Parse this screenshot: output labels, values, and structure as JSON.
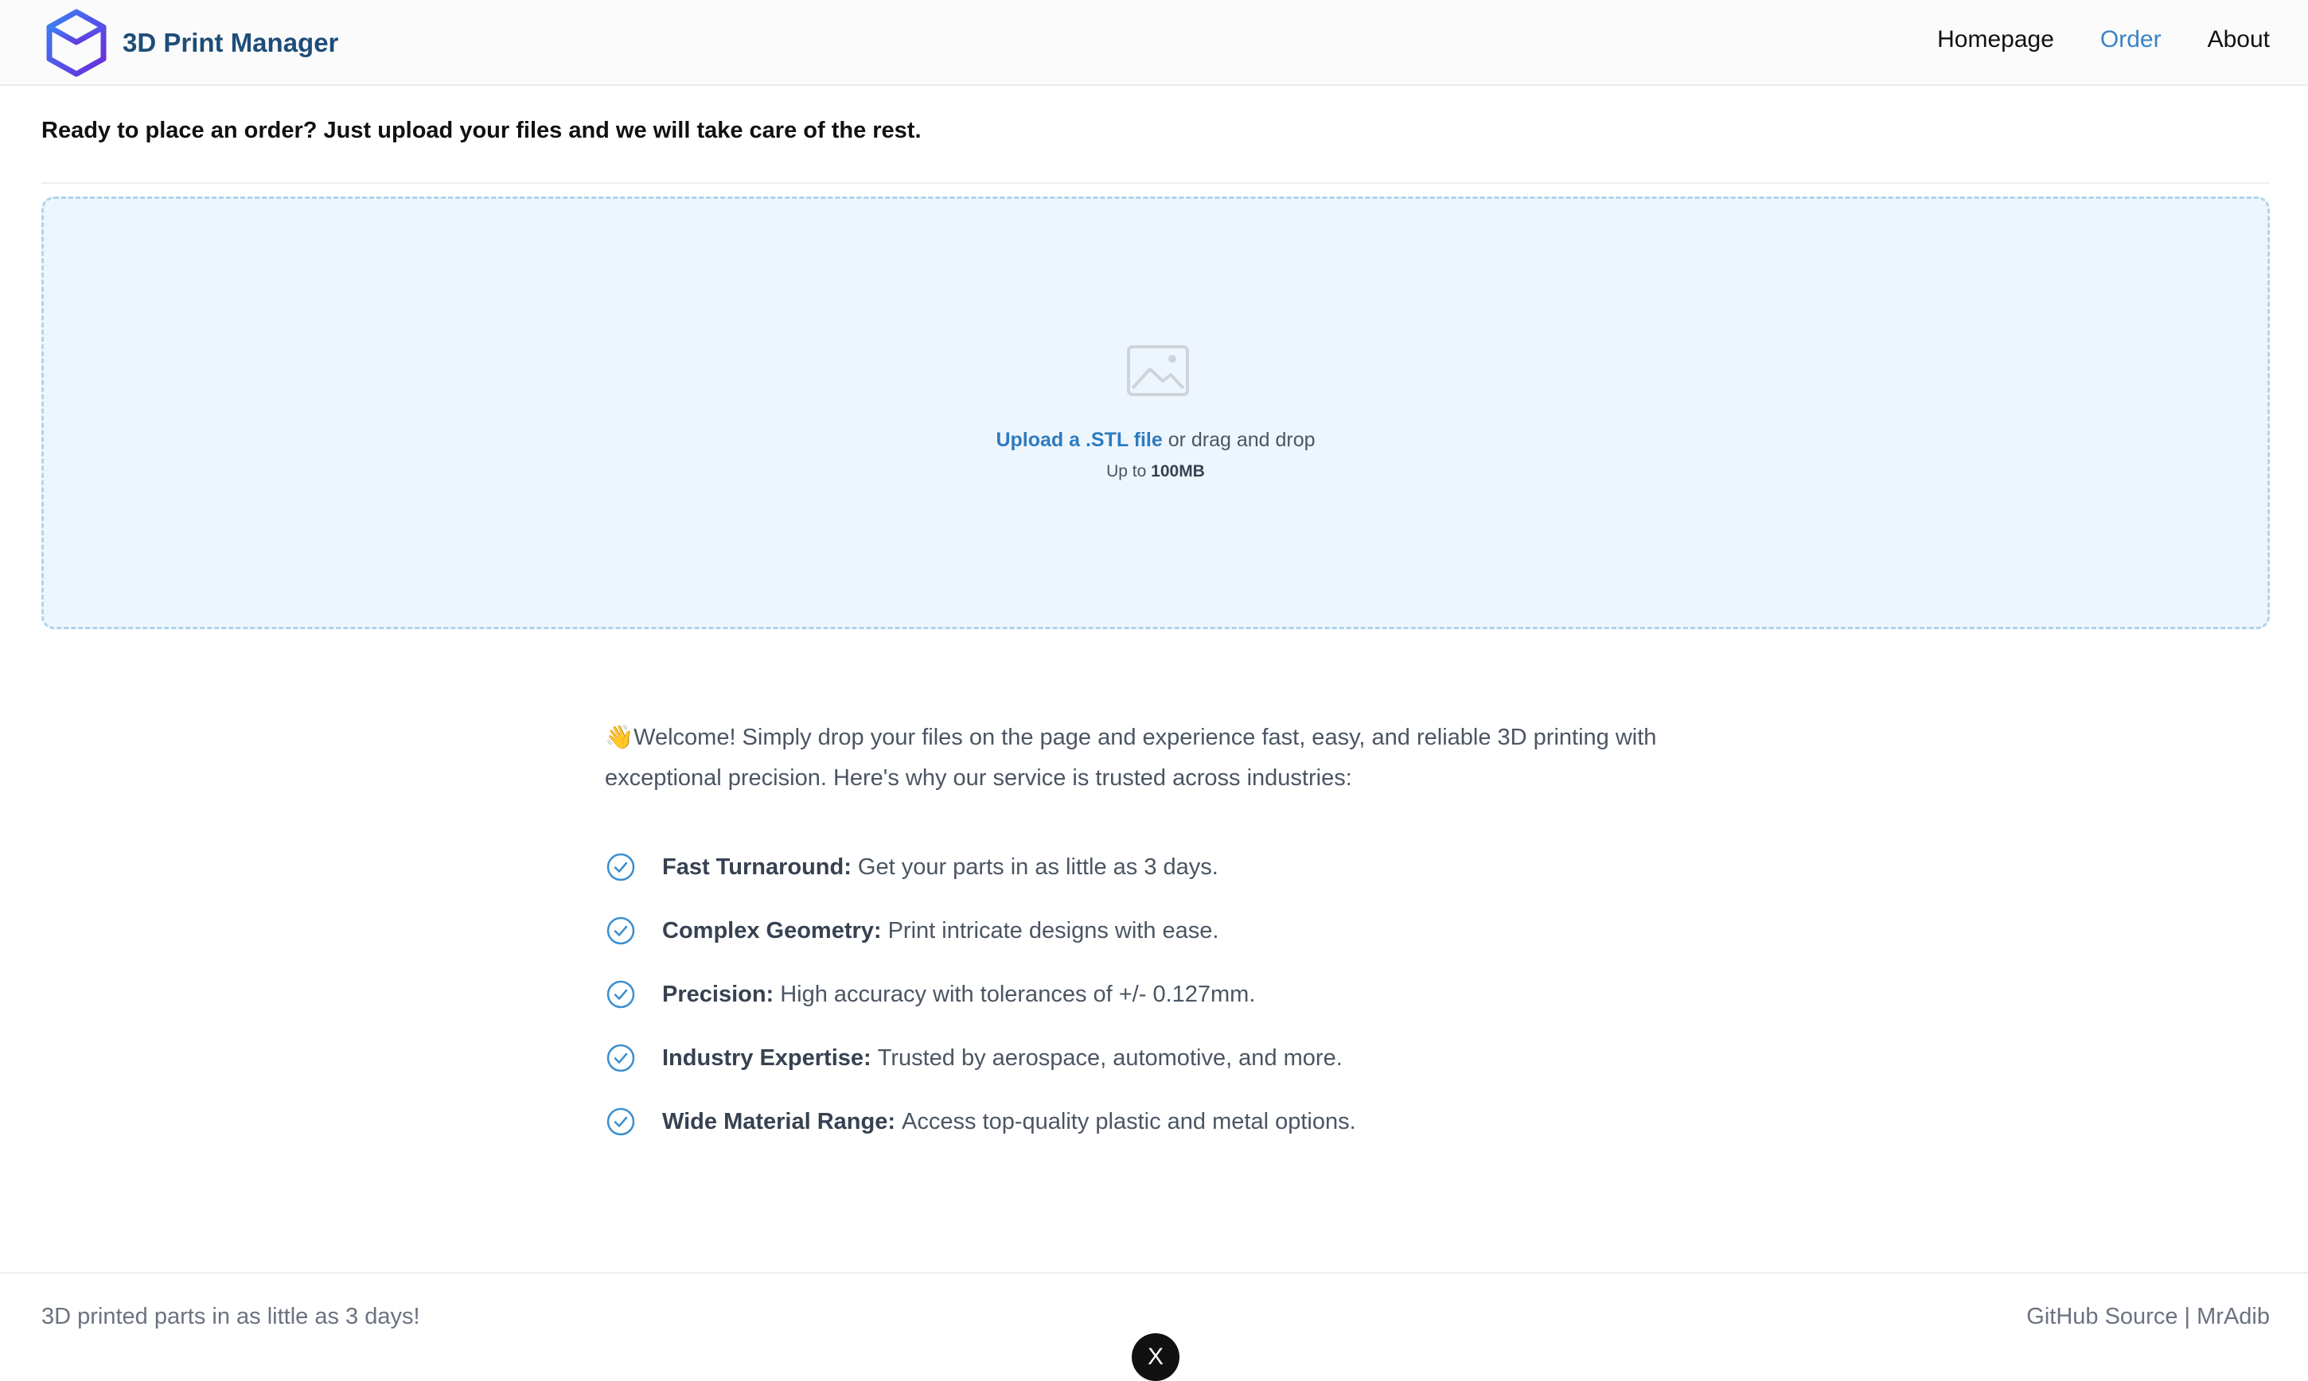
{
  "app": {
    "name": "3D Print Manager",
    "accent_color": "#3b82c4",
    "brand_color": "#1e4d78"
  },
  "nav": {
    "items": [
      {
        "label": "Homepage",
        "active": false
      },
      {
        "label": "Order",
        "active": true
      },
      {
        "label": "About",
        "active": false
      }
    ]
  },
  "intro": {
    "text": "Ready to place an order? Just upload your files and we will take care of the rest."
  },
  "upload": {
    "icon": "image-icon",
    "link_label": "Upload a .STL file",
    "suffix": " or drag and drop",
    "limit_prefix": "Up to ",
    "limit_value": "100MB"
  },
  "welcome": {
    "emoji": "👋",
    "text": "Welcome! Simply drop your files on the page and experience fast, easy, and reliable 3D printing with exceptional precision. Here's why our service is trusted across industries:"
  },
  "features": [
    {
      "title": "Fast Turnaround:",
      "description": "Get your parts in as little as 3 days."
    },
    {
      "title": "Complex Geometry:",
      "description": "Print intricate designs with ease."
    },
    {
      "title": "Precision:",
      "description": "High accuracy with tolerances of +/- 0.127mm."
    },
    {
      "title": "Industry Expertise:",
      "description": "Trusted by aerospace, automotive, and more."
    },
    {
      "title": "Wide Material Range:",
      "description": "Access top-quality plastic and metal options."
    }
  ],
  "footer": {
    "tagline": "3D printed parts in as little as 3 days!",
    "github_label": "GitHub Source",
    "separator": "|",
    "author_label": "MrAdib",
    "fab_glyph": "X"
  }
}
